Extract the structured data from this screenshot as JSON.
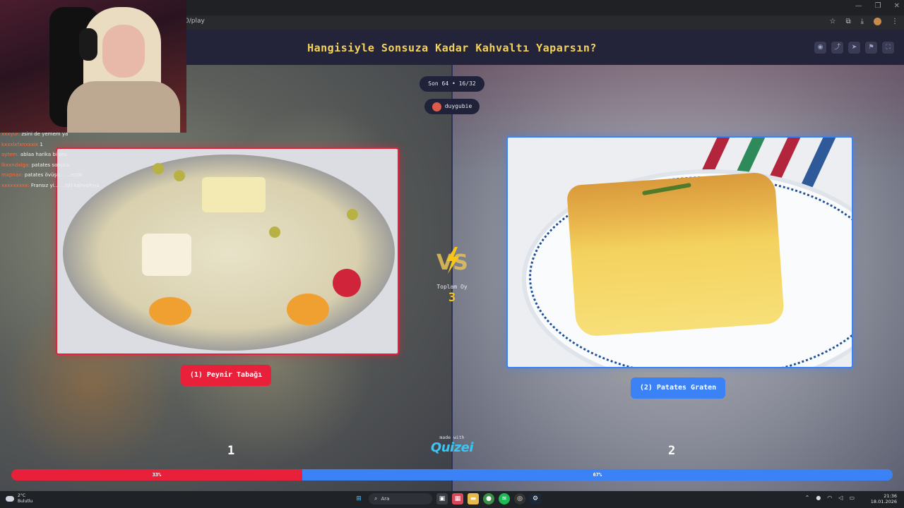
{
  "browser": {
    "url": "0/play",
    "window_controls": [
      "—",
      "❐",
      "✕"
    ],
    "toolbar_icons": [
      "☆",
      "⧉",
      "⤓",
      "⋮"
    ]
  },
  "header": {
    "title": "Hangisiyle Sonsuza Kadar Kahvaltı Yaparsın?",
    "icons": [
      "eye-icon",
      "share-icon",
      "send-icon",
      "bookmark-icon",
      "fullscreen-icon"
    ],
    "icon_glyphs": [
      "◉",
      "⤴",
      "➤",
      "⚑",
      "⛶"
    ]
  },
  "round": {
    "label": "Son 64 • 16/32"
  },
  "user": {
    "name": "duygubie"
  },
  "chat": [
    {
      "user": "xxxyur:",
      "msg": "zsini de yemem ya"
    },
    {
      "user": "kxxxlxfxnxxxix",
      "msg": "1"
    },
    {
      "user": "aytem:",
      "msg": "ablaa harika bi ses"
    },
    {
      "user": "lkxxndalga:",
      "msg": "patates sonucu"
    },
    {
      "user": "mxpnax:",
      "msg": "patates övüşü... ...ectik"
    },
    {
      "user": "xxxxxxxxx:",
      "msg": "Fransız yi... ...işti kahvaltıya"
    }
  ],
  "options": {
    "left": {
      "label": "(1) Peynir Tabağı",
      "number": "1",
      "percent_label": "33%",
      "percent": 33
    },
    "right": {
      "label": "(2) Patates Graten",
      "number": "2",
      "percent_label": "67%",
      "percent": 67
    }
  },
  "vs": {
    "total_label": "Toplam Oy",
    "total_value": "3"
  },
  "footer": {
    "made_with": "made with",
    "logo": "Quizei"
  },
  "colors": {
    "left_accent": "#e8203a",
    "right_accent": "#3b82f6",
    "title": "#f5d35b",
    "total": "#f5c518"
  },
  "taskbar": {
    "weather_temp": "2°C",
    "weather_desc": "Bulutlu",
    "search_placeholder": "Ara",
    "time": "21:36",
    "date": "18.01.2026",
    "apps": [
      "start-icon",
      "search-icon",
      "taskview-icon",
      "widgets-icon",
      "files-icon",
      "chrome-icon",
      "spotify-icon",
      "obs-icon",
      "steam-icon"
    ]
  }
}
